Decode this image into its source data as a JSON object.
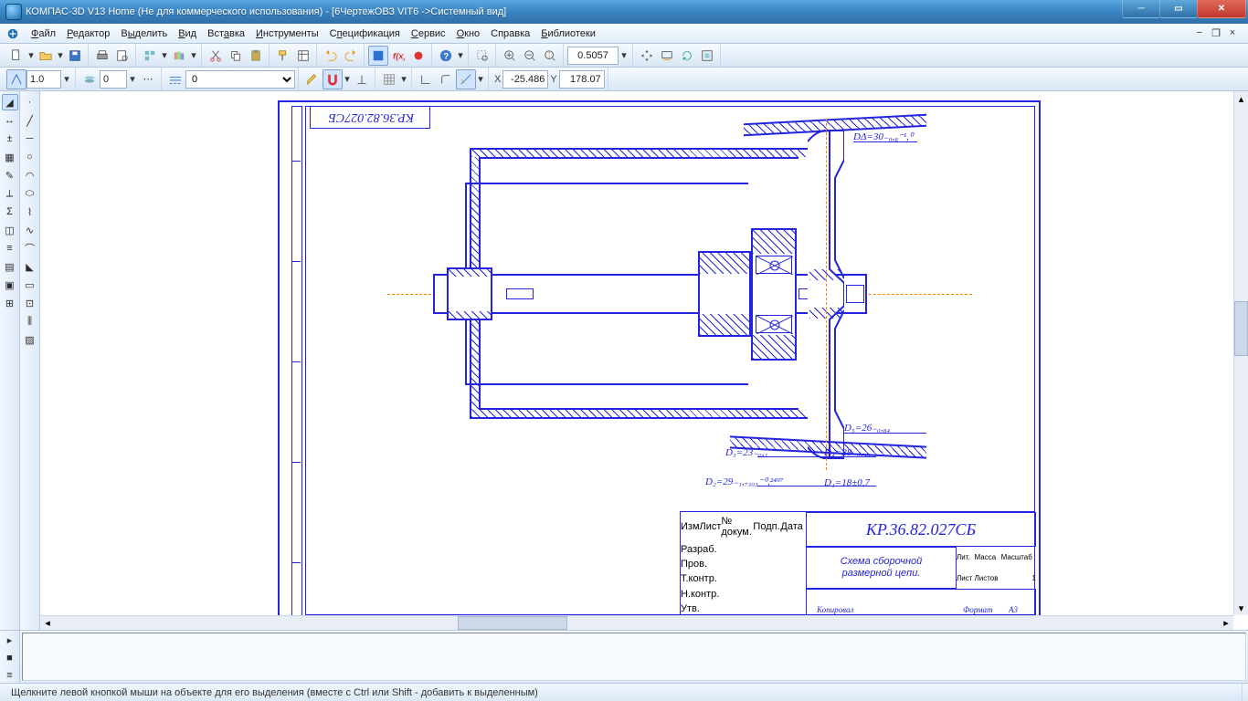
{
  "title": "КОМПАС-3D V13 Home (Не для коммерческого использования) - [6ЧертежОВЗ VIT6 ->Системный вид]",
  "menu": {
    "file": "Файл",
    "edit": "Редактор",
    "select": "Выделить",
    "view": "Вид",
    "insert": "Вставка",
    "tools": "Инструменты",
    "spec": "Спецификация",
    "service": "Сервис",
    "window": "Окно",
    "help": "Справка",
    "libs": "Библиотеки"
  },
  "tb1": {
    "zoom_value": "0.5057"
  },
  "tb2": {
    "step": "1.0",
    "layer": "0",
    "style": "0",
    "coord_x_label": "X",
    "coord_x": "-25.486",
    "coord_y_label": "Y",
    "coord_y": "178.07"
  },
  "drawing": {
    "doc_code_top": "КР.36.82.027СБ",
    "doc_code": "КР.36.82.027СБ",
    "doc_title1": "Схема сборочной",
    "doc_title2": "размерной цепи.",
    "tb_labels": {
      "izm": "Изм",
      "list": "Лист",
      "ndok": "№ докум.",
      "podp": "Подп.",
      "data": "Дата",
      "razrab": "Разраб.",
      "prov": "Пров.",
      "tkontr": "Т.контр.",
      "nkontr": "Н.контр.",
      "utv": "Утв.",
      "lit": "Лит.",
      "massa": "Масса",
      "mashtab": "Масштаб",
      "list_lbl": "Лист",
      "listov_lbl": "Листов",
      "listov_val": "1",
      "kopiroval": "Копировал",
      "format": "Формат",
      "format_v": "A3"
    },
    "dims": {
      "d1": "D₁=18±0,7",
      "d2": "D₂=29₋₁,₇₃₀₃⁻⁰,²⁴⁹⁷",
      "d3": "D₃=23₋₀,₁",
      "d4": "D₄=28₋₀,₉₆",
      "d5": "D₅=26₋₀,₈₄",
      "d_delta": "DΔ=30₋₀,₈⁻¹,⁰"
    }
  },
  "status": "Щелкните левой кнопкой мыши на объекте для его выделения (вместе с Ctrl или Shift - добавить к выделенным)"
}
